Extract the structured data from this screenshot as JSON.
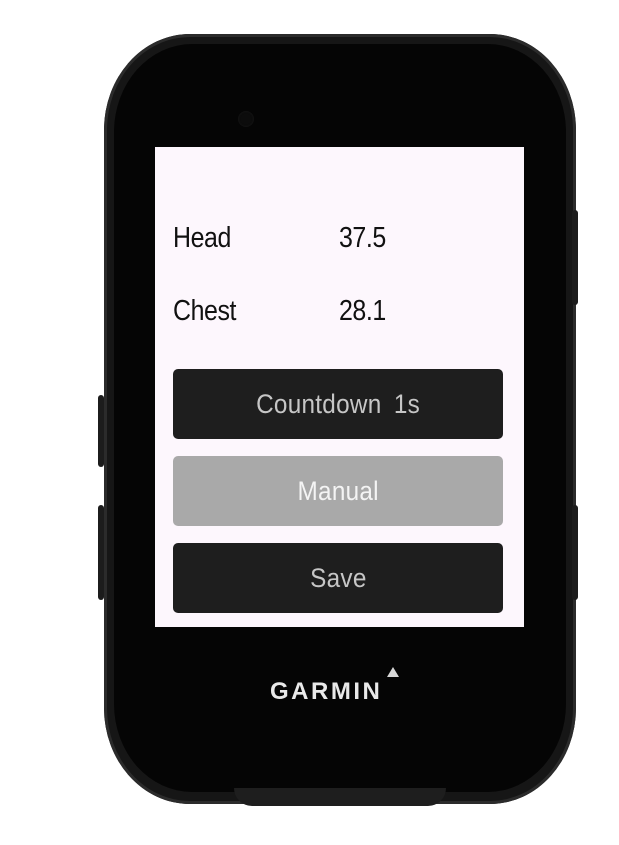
{
  "device": {
    "brand": "GARMIN"
  },
  "screen": {
    "rows": [
      {
        "label": "Head",
        "value": "37.5"
      },
      {
        "label": "Chest",
        "value": "28.1"
      }
    ],
    "buttons": {
      "countdown": "Countdown  1s",
      "manual": "Manual",
      "save": "Save"
    }
  },
  "colors": {
    "screen_bg": "#fdf7fd",
    "button_dark": "#1e1e1e",
    "button_selected": "#a9a9a9",
    "device_body": "#161616"
  }
}
